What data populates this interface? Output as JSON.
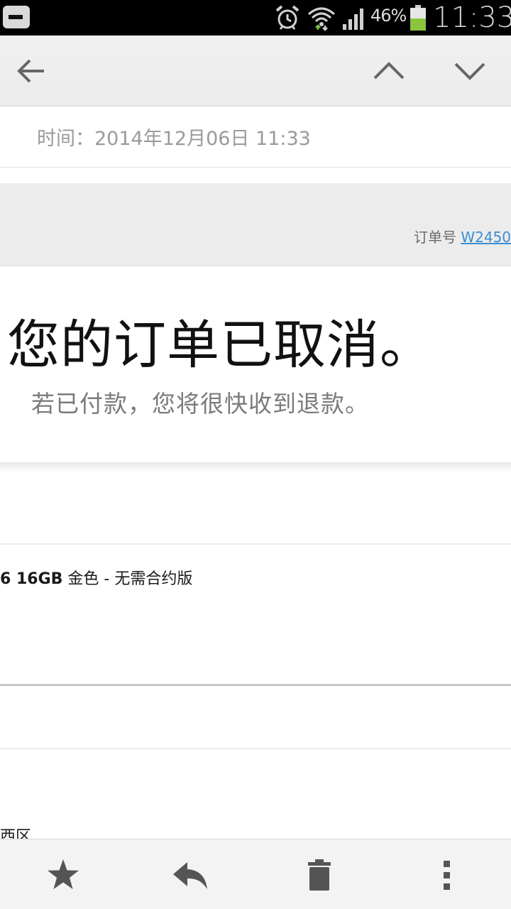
{
  "status_bar": {
    "battery_percent": "46%",
    "time": "11:33",
    "icons": [
      "notification-minus-icon",
      "alarm-clock-icon",
      "wifi-icon",
      "cell-signal-icon",
      "battery-icon"
    ]
  },
  "app_bar": {
    "icons": [
      "back-arrow-icon",
      "chevron-up-icon",
      "chevron-down-icon"
    ]
  },
  "message": {
    "time_text": "时间：2014年12月06日 11:33",
    "order_label": "订单号 ",
    "order_number": "W2450",
    "headline": "您的订单已取消。",
    "subline": "若已付款，您将很快收到退款。",
    "product_bold": "6 16GB",
    "product_rest": " 金色 - 无需合约版",
    "address_partial": "西区"
  },
  "bottom_bar": {
    "icons": [
      "star-icon",
      "reply-icon",
      "trash-icon",
      "more-vert-icon"
    ]
  },
  "colors": {
    "link": "#3b8fd4",
    "battery_fill": "#8bc53f",
    "status_bar_bg": "#000000"
  }
}
